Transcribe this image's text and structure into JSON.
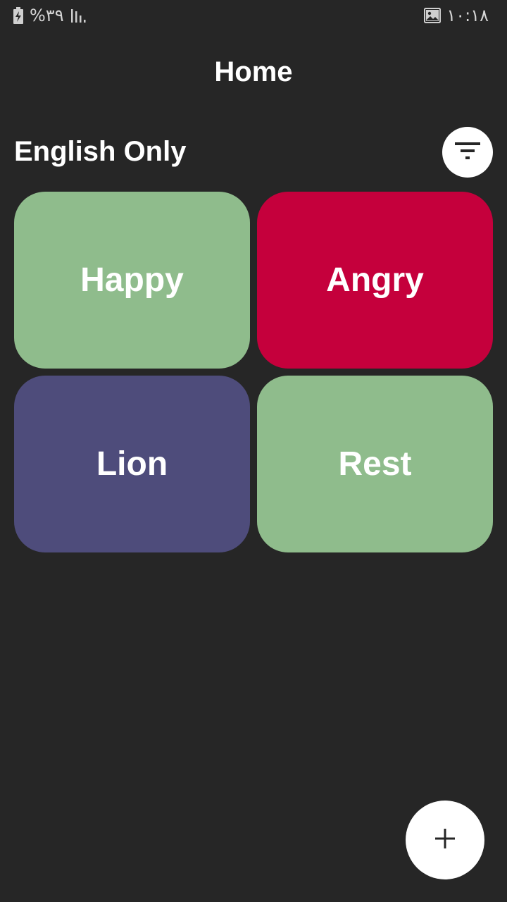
{
  "status_bar": {
    "battery_text": "%۳۹",
    "time": "۱۰:۱۸",
    "icons": [
      "battery-charging-icon",
      "signal-icon",
      "image-icon"
    ]
  },
  "header": {
    "title": "Home"
  },
  "section": {
    "title": "English Only",
    "filter_icon": "filter-icon"
  },
  "tiles": [
    {
      "label": "Happy",
      "color": "#8fbc8c"
    },
    {
      "label": "Angry",
      "color": "#c5003c"
    },
    {
      "label": "Lion",
      "color": "#4e4c7b"
    },
    {
      "label": "Rest",
      "color": "#8fbc8c"
    }
  ],
  "fab": {
    "icon": "plus-icon"
  },
  "colors": {
    "background": "#262626",
    "surface_light": "#ffffff",
    "text": "#ffffff"
  }
}
